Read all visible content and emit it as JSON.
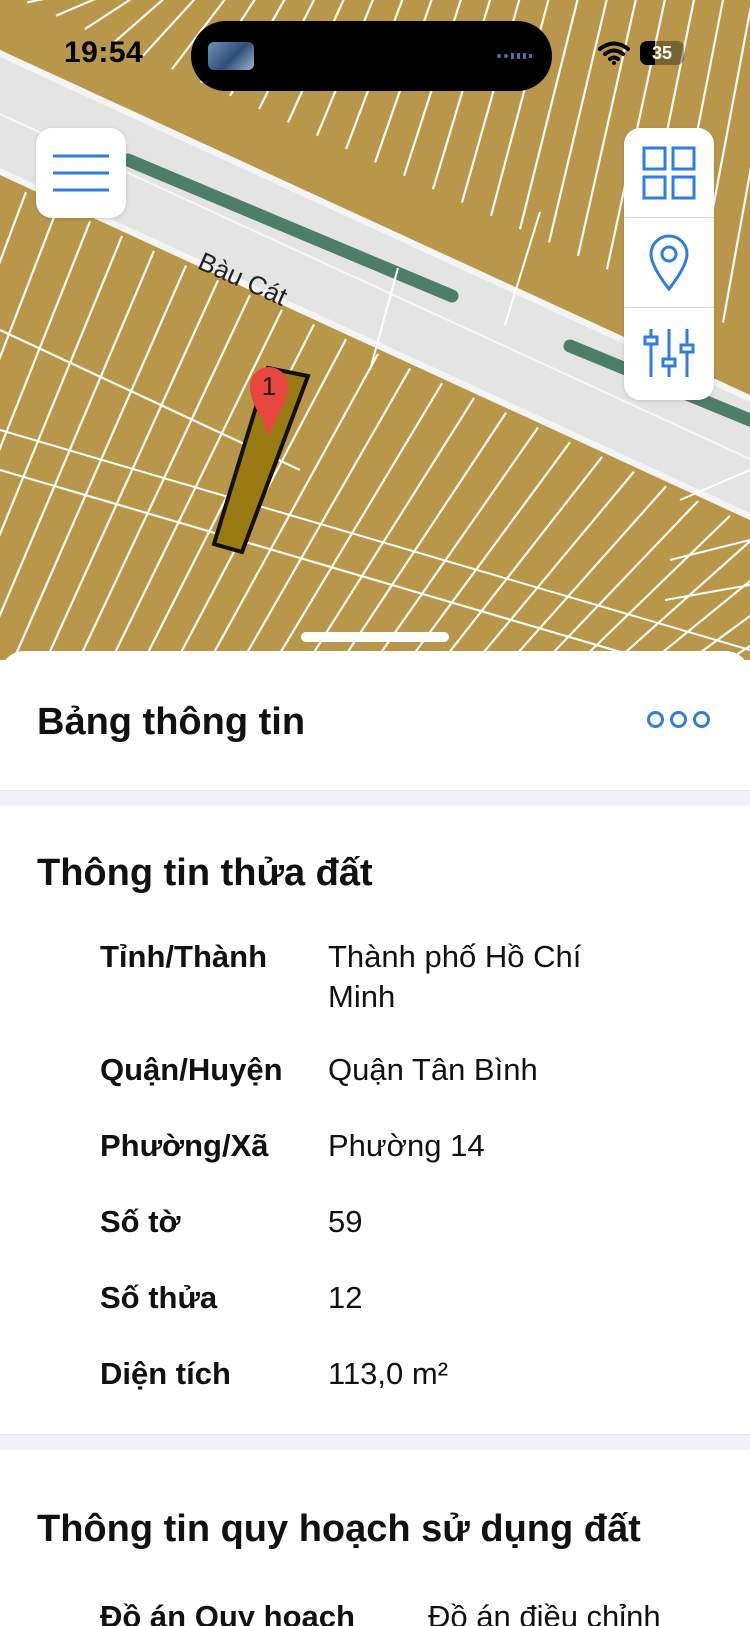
{
  "status_bar": {
    "time": "19:54",
    "battery_level": "35",
    "battery_fraction": 0.35
  },
  "map": {
    "street_label": "Bàu Cát",
    "marker_label": "1",
    "colors": {
      "land": "#b9974a",
      "road": "#e4e4e4",
      "median": "#4e7e6a",
      "selected_parcel": "#9a7a12"
    }
  },
  "controls": {
    "menu_icon": "hamburger-icon",
    "layers_icon": "grid-icon",
    "location_icon": "location-pin-icon",
    "filter_icon": "sliders-icon",
    "accent_color": "#2f7de1"
  },
  "sheet": {
    "title": "Bảng thông tin",
    "more_icon": "ellipsis-icon",
    "parcel_section": {
      "title": "Thông tin thửa đất",
      "rows": [
        {
          "label": "Tỉnh/Thành",
          "value": "Thành phố Hồ Chí Minh"
        },
        {
          "label": "Quận/Huyện",
          "value": "Quận Tân Bình"
        },
        {
          "label": "Phường/Xã",
          "value": "Phường 14"
        },
        {
          "label": "Số tờ",
          "value": "59"
        },
        {
          "label": "Số thửa",
          "value": "12"
        },
        {
          "label": "Diện tích",
          "value": "113,0 m²"
        }
      ]
    },
    "planning_section": {
      "title": "Thông tin quy hoạch sử dụng đất",
      "first_row": {
        "label": "Đồ án Quy hoạch",
        "value": "Đồ án điều chỉnh"
      }
    }
  }
}
